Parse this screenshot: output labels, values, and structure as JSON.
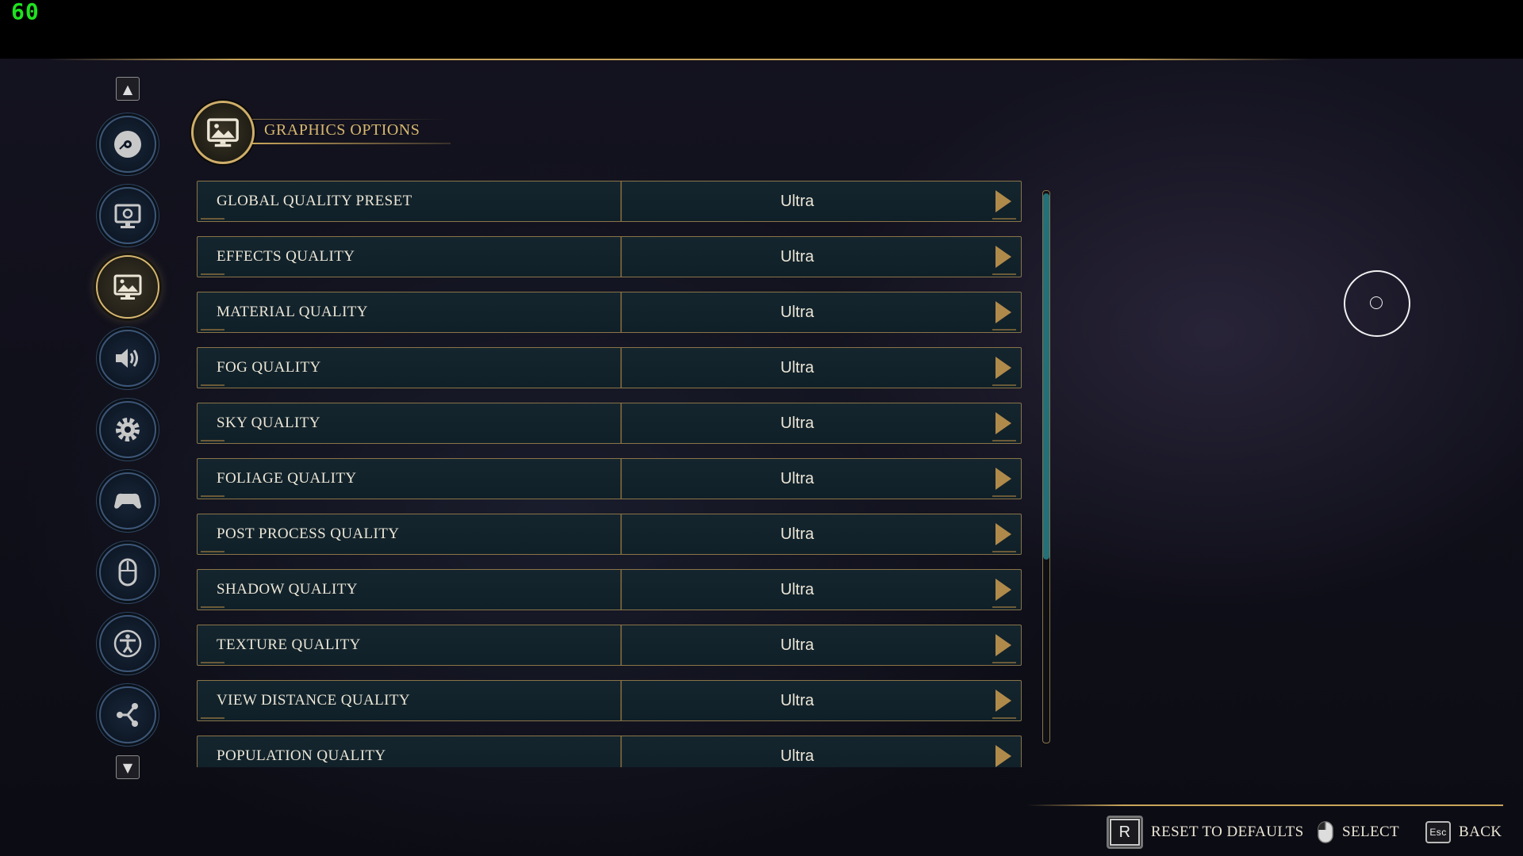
{
  "hud": {
    "fps": "60"
  },
  "header": {
    "title": "GRAPHICS OPTIONS",
    "icon": "landscape-monitor-icon"
  },
  "sidebar": {
    "items": [
      {
        "id": "game",
        "icon": "disc-icon"
      },
      {
        "id": "display",
        "icon": "monitor-gear-icon"
      },
      {
        "id": "graphics",
        "icon": "landscape-monitor-icon",
        "active": true
      },
      {
        "id": "audio",
        "icon": "speaker-icon"
      },
      {
        "id": "gameplay",
        "icon": "gear-icon"
      },
      {
        "id": "controller",
        "icon": "gamepad-icon"
      },
      {
        "id": "mouse",
        "icon": "mouse-icon"
      },
      {
        "id": "accessibility",
        "icon": "accessibility-icon"
      },
      {
        "id": "social",
        "icon": "share-icon"
      }
    ]
  },
  "settings": [
    {
      "label": "GLOBAL QUALITY PRESET",
      "value": "Ultra"
    },
    {
      "label": "EFFECTS QUALITY",
      "value": "Ultra"
    },
    {
      "label": "MATERIAL QUALITY",
      "value": "Ultra"
    },
    {
      "label": "FOG QUALITY",
      "value": "Ultra"
    },
    {
      "label": "SKY QUALITY",
      "value": "Ultra"
    },
    {
      "label": "FOLIAGE QUALITY",
      "value": "Ultra"
    },
    {
      "label": "POST PROCESS QUALITY",
      "value": "Ultra"
    },
    {
      "label": "SHADOW QUALITY",
      "value": "Ultra"
    },
    {
      "label": "TEXTURE QUALITY",
      "value": "Ultra"
    },
    {
      "label": "VIEW DISTANCE QUALITY",
      "value": "Ultra"
    },
    {
      "label": "POPULATION QUALITY",
      "value": "Ultra"
    }
  ],
  "scrollbar": {
    "visible_fraction": 0.66,
    "position": 0
  },
  "footer": {
    "reset": {
      "key": "R",
      "label": "RESET TO DEFAULTS"
    },
    "select": {
      "key_icon": "mouse-click-icon",
      "label": "SELECT"
    },
    "back": {
      "key": "Esc",
      "label": "BACK"
    }
  },
  "colors": {
    "gold": "#c9a55a",
    "row_bg": "#14252e",
    "scroll_thumb": "#23707a",
    "fps": "#1fe21f"
  }
}
